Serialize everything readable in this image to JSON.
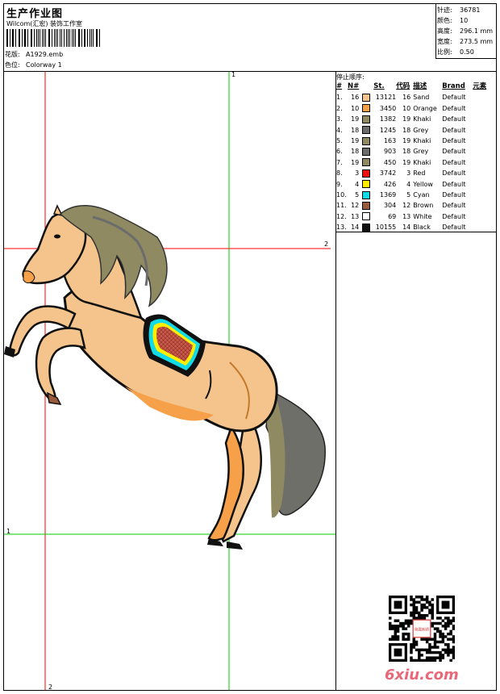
{
  "header": {
    "title": "生产作业图",
    "company": "Wilcom(汇宏) 装饰工作室",
    "design_label": "花版:",
    "design_value": "A1929.emb",
    "colorway_label": "色位:",
    "colorway_value": "Colorway 1"
  },
  "stats": [
    {
      "label": "针迹:",
      "value": "36781"
    },
    {
      "label": "颜色:",
      "value": "10"
    },
    {
      "label": "高度:",
      "value": "296.1 mm"
    },
    {
      "label": "宽度:",
      "value": "273.5 mm"
    },
    {
      "label": "比例:",
      "value": "0.50"
    }
  ],
  "stop_sequence": {
    "title": "停止顺序:",
    "headers": {
      "num": "#",
      "n": "N#",
      "st": "St.",
      "code": "代码",
      "desc": "描述",
      "brand": "Brand",
      "elem": "元素"
    },
    "rows": [
      {
        "num": "1.",
        "n": "16",
        "color": "#f4c48c",
        "st": "13121",
        "code": "16",
        "desc": "Sand",
        "brand": "Default"
      },
      {
        "num": "2.",
        "n": "10",
        "color": "#f7a04a",
        "st": "3450",
        "code": "10",
        "desc": "Orange",
        "brand": "Default"
      },
      {
        "num": "3.",
        "n": "19",
        "color": "#8f8a62",
        "st": "1382",
        "code": "19",
        "desc": "Khaki",
        "brand": "Default"
      },
      {
        "num": "4.",
        "n": "18",
        "color": "#6c6c6c",
        "st": "1245",
        "code": "18",
        "desc": "Grey",
        "brand": "Default"
      },
      {
        "num": "5.",
        "n": "19",
        "color": "#8f8a62",
        "st": "163",
        "code": "19",
        "desc": "Khaki",
        "brand": "Default"
      },
      {
        "num": "6.",
        "n": "18",
        "color": "#6c6c6c",
        "st": "903",
        "code": "18",
        "desc": "Grey",
        "brand": "Default"
      },
      {
        "num": "7.",
        "n": "19",
        "color": "#8f8a62",
        "st": "450",
        "code": "19",
        "desc": "Khaki",
        "brand": "Default"
      },
      {
        "num": "8.",
        "n": "3",
        "color": "#ee1111",
        "st": "3742",
        "code": "3",
        "desc": "Red",
        "brand": "Default"
      },
      {
        "num": "9.",
        "n": "4",
        "color": "#ffee00",
        "st": "426",
        "code": "4",
        "desc": "Yellow",
        "brand": "Default"
      },
      {
        "num": "10.",
        "n": "5",
        "color": "#12dbe8",
        "st": "1369",
        "code": "5",
        "desc": "Cyan",
        "brand": "Default"
      },
      {
        "num": "11.",
        "n": "12",
        "color": "#9a5a3c",
        "st": "304",
        "code": "12",
        "desc": "Brown",
        "brand": "Default"
      },
      {
        "num": "12.",
        "n": "13",
        "color": "#ffffff",
        "st": "69",
        "code": "13",
        "desc": "White",
        "brand": "Default"
      },
      {
        "num": "13.",
        "n": "14",
        "color": "#111111",
        "st": "10155",
        "code": "14",
        "desc": "Black",
        "brand": "Default"
      }
    ]
  },
  "markers": {
    "top": "1",
    "right": "2",
    "left": "1",
    "bottom": "2"
  },
  "watermark": "6xiu.com",
  "qr_seal": "晓霞刺绣"
}
